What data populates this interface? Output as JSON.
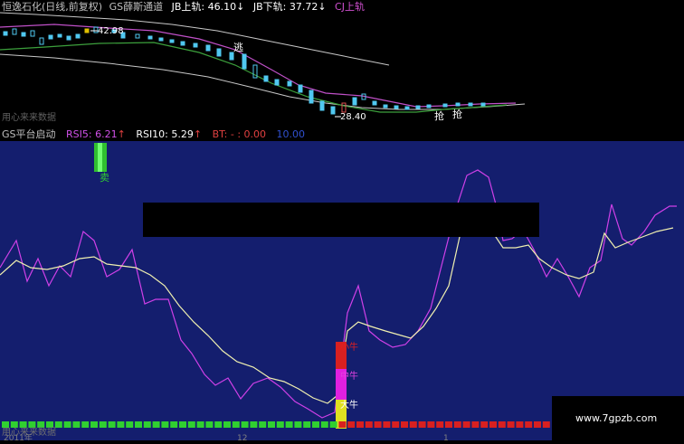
{
  "top_header": {
    "stock_title": "恒逸石化(日线,前复权)",
    "indicator_name": "GS薛斯通道",
    "jb_upper_label": "JB上轨:",
    "jb_upper_value": "46.10",
    "jb_upper_arrow": "↓",
    "jb_lower_label": "JB下轨:",
    "jb_lower_value": "37.72",
    "jb_lower_arrow": "↓",
    "cj_upper_label": "CJ上轨"
  },
  "top_chart": {
    "high_marker": "42.98",
    "low_marker": "28.40",
    "signal_tao": "逃",
    "signal_qiang_1": "抢",
    "signal_qiang_2": "抢",
    "footer_text": "用心来来数据",
    "colors": {
      "upper_band": "#c8c8c8",
      "lower_band": "#c8c8c8",
      "mid_purple": "#c050c8",
      "mid_green": "#3ca03c",
      "candle": "#50c8f0"
    }
  },
  "bottom_header": {
    "indicator_name": "GS平台启动",
    "rsi5_label": "RSI5:",
    "rsi5_value": "6.21",
    "rsi5_arrow": "↑",
    "rsi10_label": "RSI10:",
    "rsi10_value": "5.29",
    "rsi10_arrow": "↑",
    "bt_label": "BT:",
    "bt_value": "- : 0.00",
    "level_value": "10.00"
  },
  "bottom_chart": {
    "sell_label": "卖",
    "bull_small": "小牛",
    "bull_mid": "中牛",
    "bull_big": "大牛",
    "footer_text": "用心来来数据",
    "axis_label_1": "2011年",
    "axis_label_2": "12",
    "axis_label_3": "1",
    "colors": {
      "rsi5": "#d040e8",
      "rsi10": "#f0f0b0",
      "bg": "#141e6e",
      "green_sq": "#30d030",
      "red_sq": "#d82020"
    }
  },
  "watermark": {
    "text": "www.7gpzb.com"
  }
}
